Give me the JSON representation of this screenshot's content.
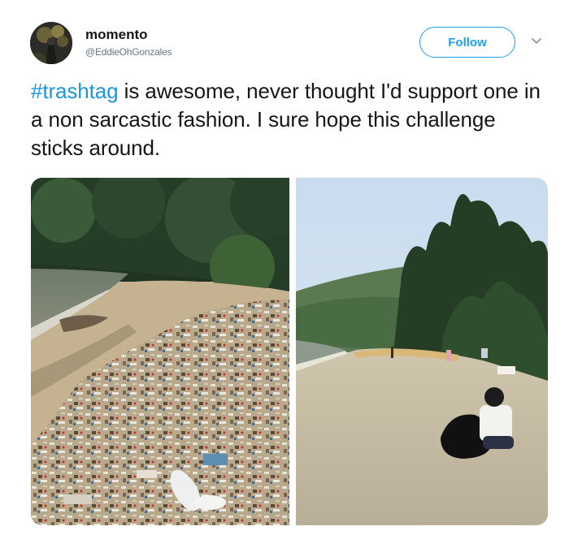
{
  "user": {
    "display_name": "momento",
    "handle": "@EddieOhGonzales",
    "avatar_icon": "profile-avatar-icon"
  },
  "actions": {
    "follow_label": "Follow",
    "more_icon": "chevron-down-icon"
  },
  "tweet": {
    "hashtag": "#trashtag",
    "text": " is awesome, never thought I'd support one in a non sarcastic fashion. I sure hope this challenge sticks around."
  },
  "colors": {
    "accent": "#1da1f2",
    "hashtag": "#1b95e0",
    "text": "#14171a",
    "secondary": "#657786"
  }
}
